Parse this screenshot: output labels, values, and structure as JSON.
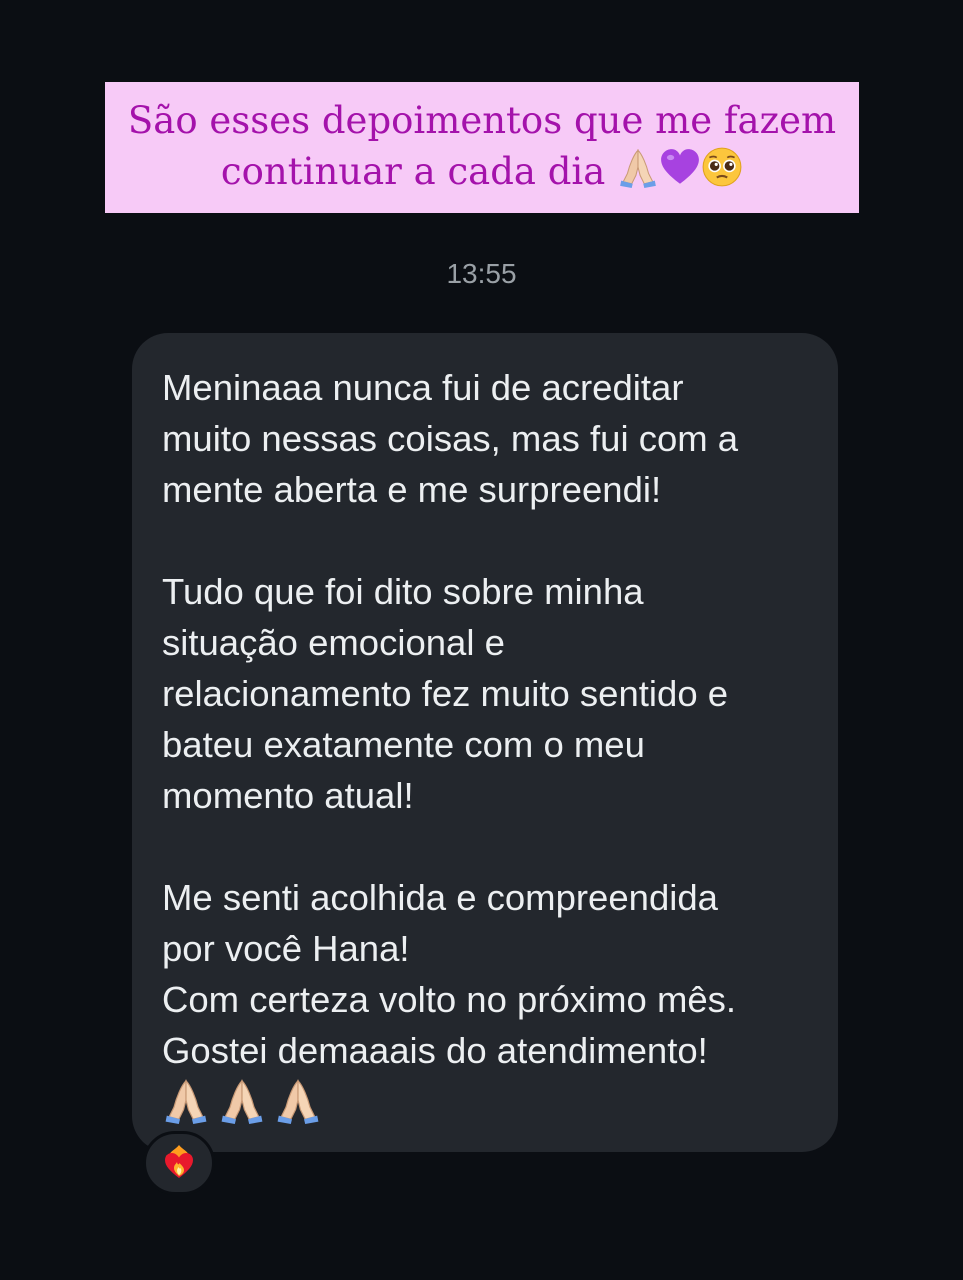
{
  "banner": {
    "line1": "São esses depoimentos que me fazem",
    "line2": "continuar a cada dia",
    "emojis": [
      "praying-hands",
      "purple-heart",
      "pleading-face"
    ],
    "colors": {
      "background": "#f7caf7",
      "text": "#a412ab"
    }
  },
  "chat": {
    "timestamp": "13:55",
    "message": {
      "paragraphs": [
        [
          "Meninaaa nunca fui de acreditar",
          "muito nessas coisas, mas fui com a",
          "mente aberta e me surpreendi!"
        ],
        [
          "Tudo que foi dito sobre minha",
          "situação emocional e",
          "relacionamento fez muito sentido e",
          "bateu exatamente com o meu",
          "momento atual!"
        ],
        [
          "Me senti acolhida e compreendida",
          "por você Hana!",
          "Com certeza volto no próximo mês.",
          "Gostei demaaais do atendimento!"
        ]
      ],
      "trailing_emojis": [
        "praying-hands",
        "praying-hands",
        "praying-hands"
      ]
    },
    "reaction": "heart-on-fire"
  },
  "colors": {
    "app_background": "#0b0e13",
    "bubble": "#23272d",
    "bubble_text": "#eceff1",
    "timestamp": "#9aa0a6"
  }
}
